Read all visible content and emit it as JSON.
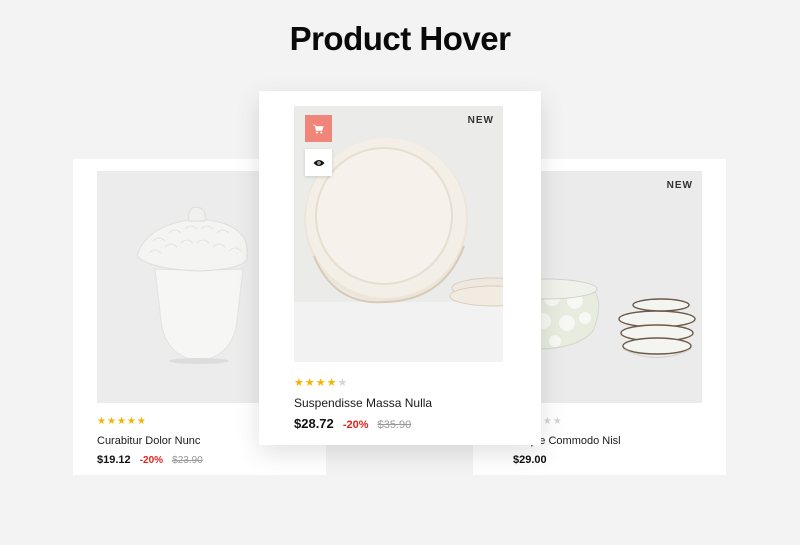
{
  "page": {
    "title": "Product Hover"
  },
  "products": [
    {
      "name": "Curabitur Dolor Nunc",
      "price": "$19.12",
      "discount": "-20%",
      "old_price": "$23.90",
      "rating": 5,
      "badge": ""
    },
    {
      "name": "Suspendisse Massa Nulla",
      "price": "$28.72",
      "discount": "-20%",
      "old_price": "$35.90",
      "rating": 4,
      "badge": "NEW"
    },
    {
      "name": "Noque Commodo Nisl",
      "price": "$29.00",
      "discount": "",
      "old_price": "",
      "rating": 0,
      "badge": "NEW"
    }
  ],
  "hover_actions": {
    "cart_icon": "cart-icon",
    "view_icon": "eye-icon"
  },
  "colors": {
    "accent": "#f0867a",
    "star": "#f5b301",
    "discount": "#e2231a",
    "background": "#f3f3f3"
  }
}
